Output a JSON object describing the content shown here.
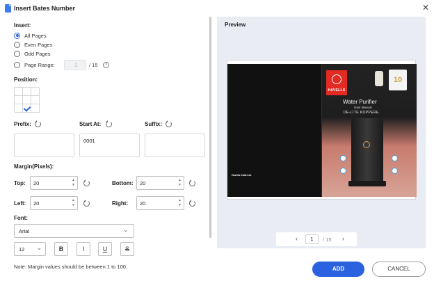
{
  "window": {
    "title": "Insert Bates Number"
  },
  "insert": {
    "label": "Insert:",
    "options": [
      {
        "label": "All Pages",
        "checked": true
      },
      {
        "label": "Even Pages",
        "checked": false
      },
      {
        "label": "Odd Pages",
        "checked": false
      },
      {
        "label": "Page Range:",
        "checked": false
      }
    ],
    "range_value": "1",
    "range_total": "/ 15"
  },
  "position": {
    "label": "Position:",
    "selected_cell": "middle-left"
  },
  "fields": {
    "prefix": {
      "label": "Prefix:",
      "value": ""
    },
    "start_at": {
      "label": "Start At:",
      "value": "0001"
    },
    "suffix": {
      "label": "Suffix:",
      "value": ""
    }
  },
  "margin": {
    "label": "Margin(Pixels):",
    "top": {
      "label": "Top:",
      "value": "20"
    },
    "bottom": {
      "label": "Bottom:",
      "value": "20"
    },
    "left": {
      "label": "Left:",
      "value": "20"
    },
    "right": {
      "label": "Right:",
      "value": "20"
    }
  },
  "font": {
    "label": "Font:",
    "family": "Arial",
    "size": "12",
    "bold": "B",
    "italic": "I",
    "underline": "U",
    "strike": "S"
  },
  "preview": {
    "label": "Preview",
    "doc_brand": "HAVELLS",
    "doc_title": "Water Purifier",
    "doc_subtitle": "User Manual",
    "doc_model": "DE-LITE KOPPERE",
    "doc_badge": "10",
    "doc_company": "Havells India Ltd.",
    "page": "1",
    "total": "/ 15"
  },
  "footer": {
    "note": "Note: Margin values should be between 1 to 100.",
    "add": "ADD",
    "cancel": "CANCEL"
  },
  "colors": {
    "accent": "#2b62df",
    "preview_bg": "#e9ecf3"
  }
}
